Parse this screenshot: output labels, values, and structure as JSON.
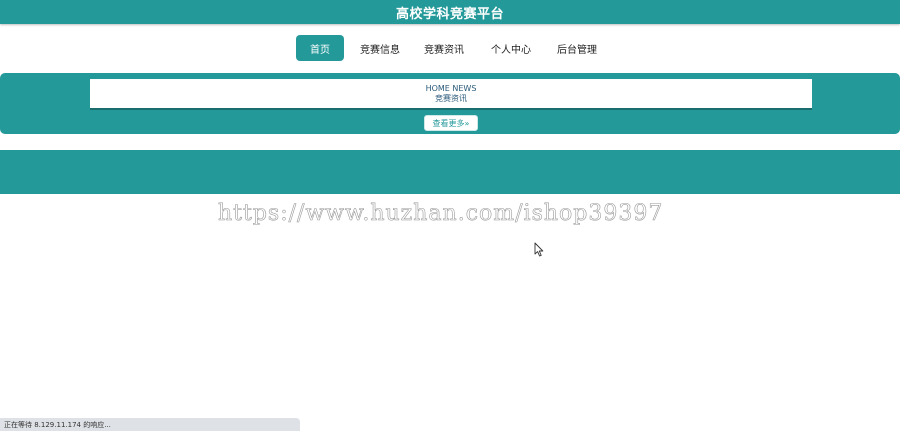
{
  "header": {
    "title": "高校学科竞赛平台"
  },
  "nav": {
    "items": [
      {
        "label": "首页",
        "active": true
      },
      {
        "label": "竞赛信息",
        "active": false
      },
      {
        "label": "竞赛资讯",
        "active": false
      },
      {
        "label": "个人中心",
        "active": false
      },
      {
        "label": "后台管理",
        "active": false
      }
    ]
  },
  "news": {
    "title_en": "HOME NEWS",
    "title_cn": "竞赛资讯",
    "more_label": "查看更多»"
  },
  "watermark": {
    "text": "https://www.huzhan.com/ishop39397"
  },
  "status_bar": {
    "text": "正在等待 8.129.11.174 的响应..."
  },
  "colors": {
    "accent": "#24999a",
    "dark_accent": "#1a6c6d",
    "status_bg": "#dee1e6"
  },
  "icons": {
    "cursor": "mouse-pointer-icon"
  }
}
